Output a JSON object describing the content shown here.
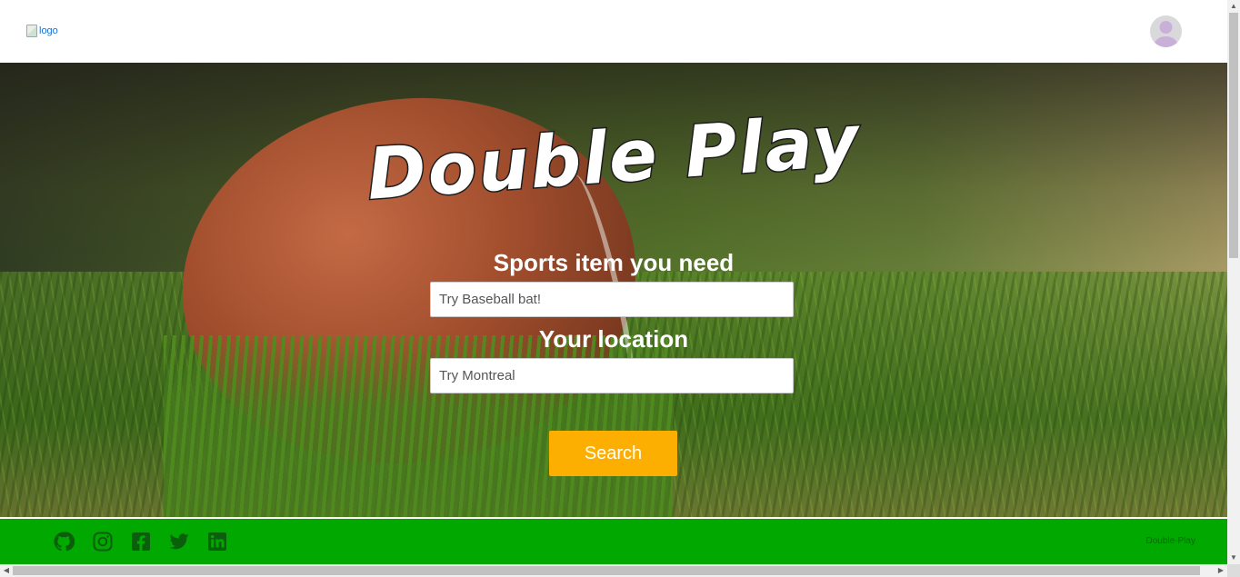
{
  "header": {
    "logo_alt": "logo",
    "avatar_icon": "user-avatar-icon"
  },
  "hero": {
    "title": "Double Play",
    "item_label": "Sports item you need",
    "item_placeholder": "Try Baseball bat!",
    "location_label": "Your location",
    "location_placeholder": "Try Montreal",
    "search_label": "Search"
  },
  "footer": {
    "social": [
      "github-icon",
      "instagram-icon",
      "facebook-icon",
      "twitter-icon",
      "linkedin-icon"
    ],
    "brand": "Double-Play"
  },
  "colors": {
    "accent_button": "#fcaf00",
    "footer_bg": "#00a800"
  }
}
